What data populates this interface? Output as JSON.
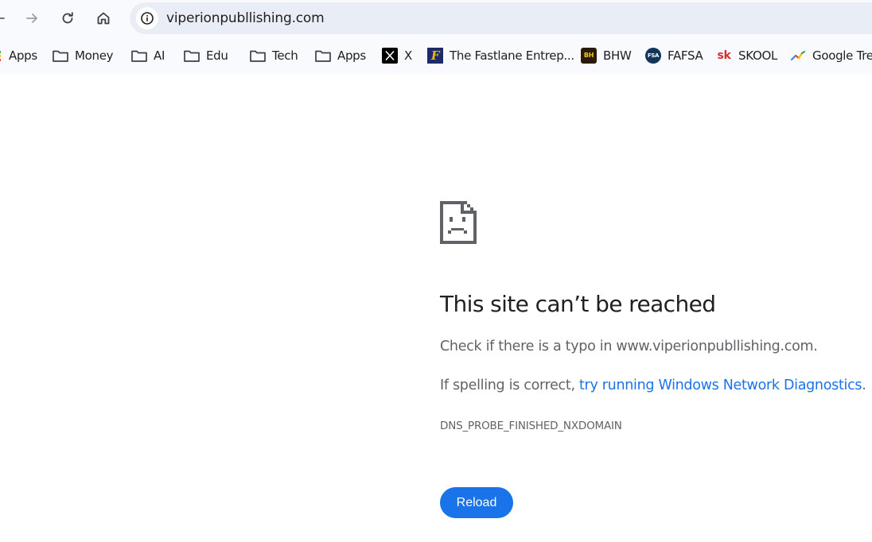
{
  "browser": {
    "url": "viperionpubllishing.com",
    "icons": {
      "back": "back-arrow-icon",
      "forward": "forward-arrow-icon",
      "reload": "reload-icon",
      "home": "home-icon",
      "site_info": "info-icon"
    }
  },
  "bookmarks": [
    {
      "label": "Apps",
      "icon": "apps-grid-icon"
    },
    {
      "label": "Money",
      "icon": "folder-icon"
    },
    {
      "label": "AI",
      "icon": "folder-icon"
    },
    {
      "label": "Edu",
      "icon": "folder-icon"
    },
    {
      "label": "Tech",
      "icon": "folder-icon"
    },
    {
      "label": "Apps",
      "icon": "folder-icon"
    },
    {
      "label": "X",
      "icon": "x-logo-icon"
    },
    {
      "label": "The Fastlane Entrep...",
      "icon": "fastlane-favicon"
    },
    {
      "label": "BHW",
      "icon": "bhw-favicon"
    },
    {
      "label": "FAFSA",
      "icon": "fafsa-favicon"
    },
    {
      "label": "SKOOL",
      "icon": "skool-favicon"
    },
    {
      "label": "Google Trends",
      "icon": "google-trends-favicon"
    }
  ],
  "error": {
    "icon": "sad-page-icon",
    "title": "This site can’t be reached",
    "line1": "Check if there is a typo in www.viperionpubllishing.com.",
    "line2_prefix": "If spelling is correct, ",
    "line2_link": "try running Windows Network Diagnostics",
    "line2_suffix": ".",
    "code": "DNS_PROBE_FINISHED_NXDOMAIN",
    "reload_label": "Reload"
  },
  "colors": {
    "accent": "#1a73e8",
    "toolbar_bg": "#f8fafd",
    "omnibox_bg": "#e9eef6",
    "text_secondary": "#5f6368"
  }
}
